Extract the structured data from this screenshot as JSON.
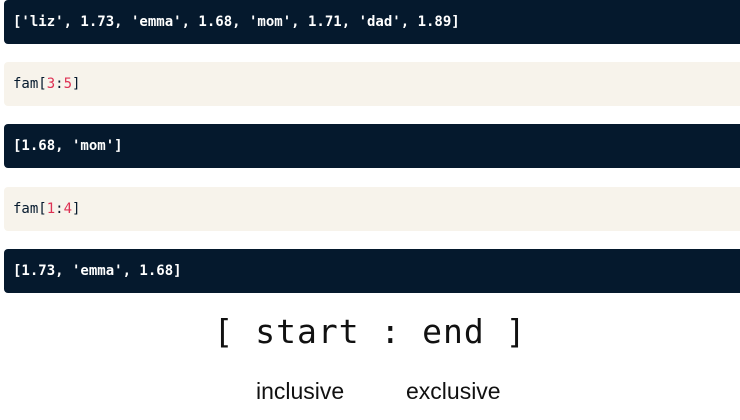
{
  "cells": {
    "output_1": "['liz', 1.73, 'emma', 1.68, 'mom', 1.71, 'dad', 1.89]",
    "input_1": {
      "prefix": "fam[",
      "start": "3",
      "sep": ":",
      "end": "5",
      "suffix": "]"
    },
    "output_2": "[1.68, 'mom']",
    "input_2": {
      "prefix": "fam[",
      "start": "1",
      "sep": ":",
      "end": "4",
      "suffix": "]"
    },
    "output_3": "[1.73, 'emma', 1.68]"
  },
  "syntax": {
    "text": "[ start : end ]",
    "inclusive_label": "inclusive",
    "exclusive_label": "exclusive"
  },
  "colors": {
    "output_bg": "#05192d",
    "input_bg": "#f7f3eb",
    "number": "#dd3153"
  }
}
